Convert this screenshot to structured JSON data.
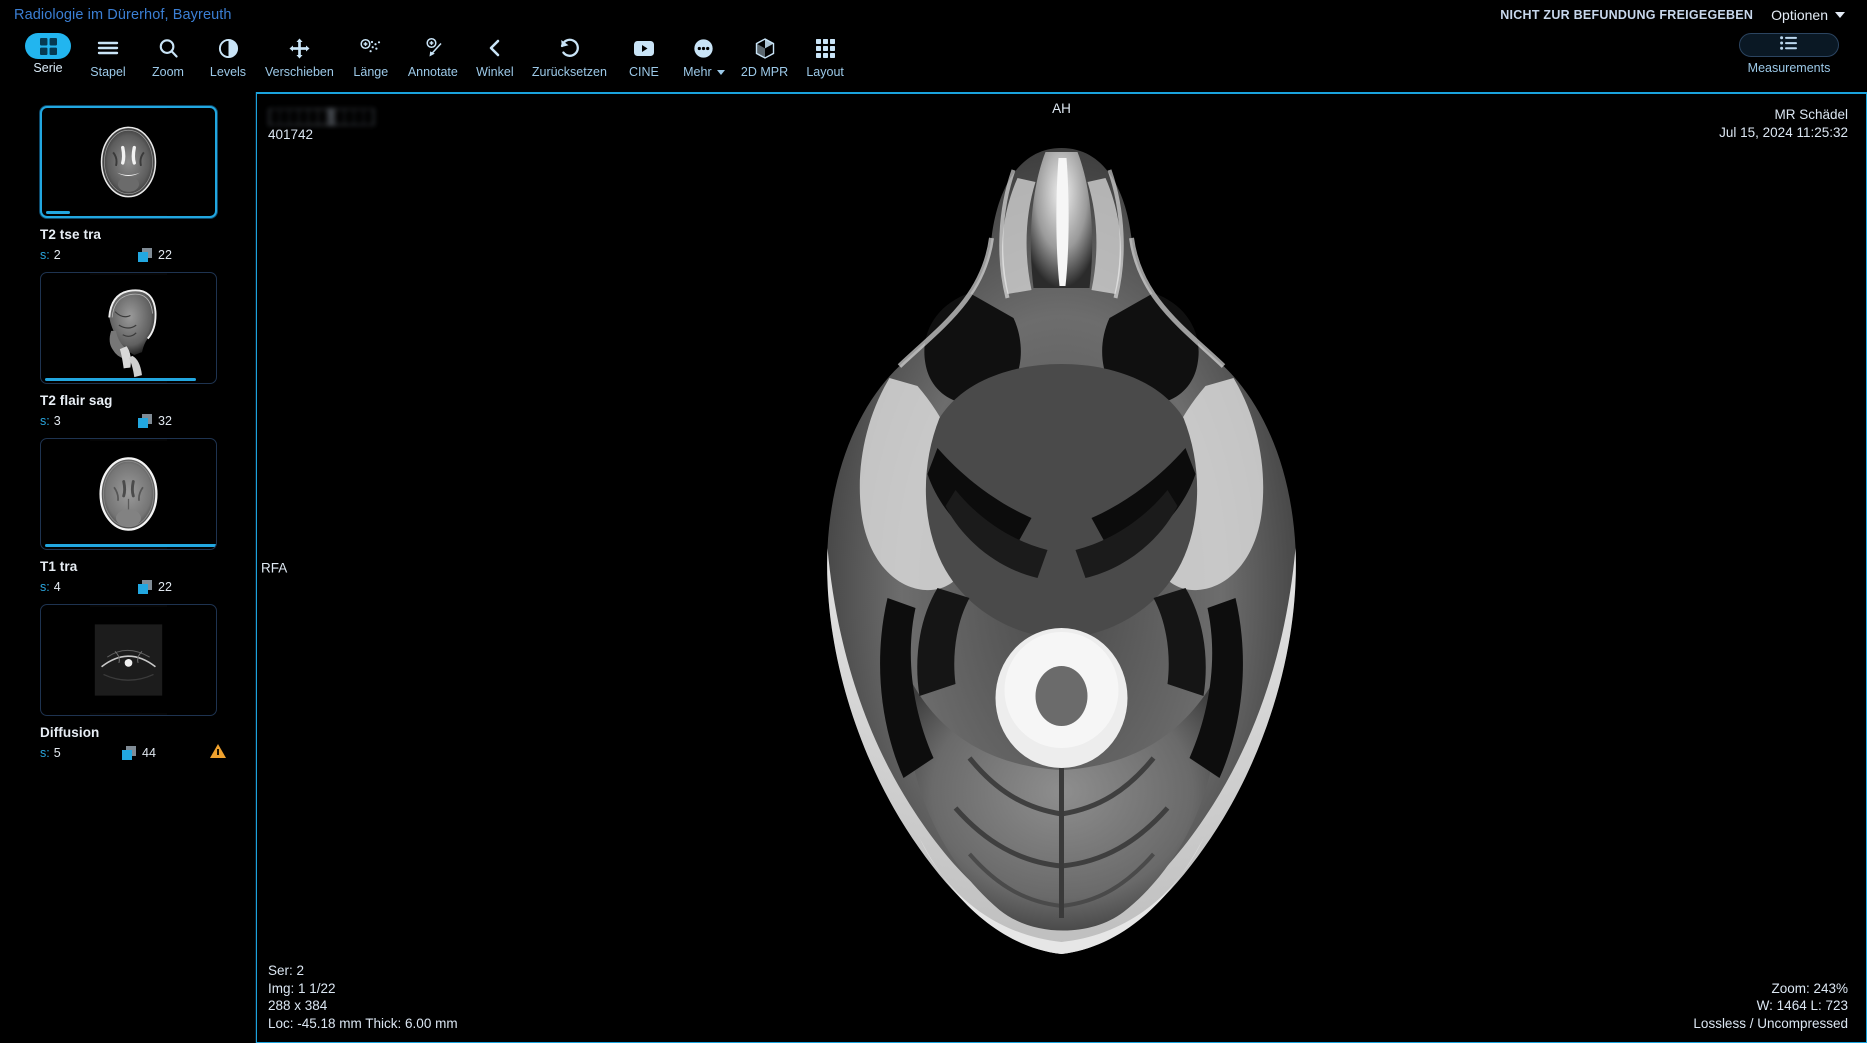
{
  "header": {
    "brand": "Radiologie im Dürerhof, Bayreuth",
    "not_released_notice": "NICHT ZUR BEFUNDUNG FREIGEGEBEN",
    "options_label": "Optionen"
  },
  "toolbar": {
    "tools": [
      {
        "label": "Serie",
        "icon": "grid-layout-icon",
        "active": true
      },
      {
        "label": "Stapel",
        "icon": "stack-lines-icon",
        "active": false
      },
      {
        "label": "Zoom",
        "icon": "magnifier-icon",
        "active": false
      },
      {
        "label": "Levels",
        "icon": "contrast-circle-icon",
        "active": false
      },
      {
        "label": "Verschieben",
        "icon": "move-arrows-icon",
        "active": false
      },
      {
        "label": "Länge",
        "icon": "length-measure-icon",
        "active": false
      },
      {
        "label": "Annotate",
        "icon": "annotate-arrow-icon",
        "active": false
      },
      {
        "label": "Winkel",
        "icon": "angle-chevron-icon",
        "active": false
      },
      {
        "label": "Zurücksetzen",
        "icon": "reset-undo-icon",
        "active": false
      },
      {
        "label": "CINE",
        "icon": "play-video-icon",
        "active": false
      },
      {
        "label": "Mehr",
        "icon": "more-dots-icon",
        "active": false,
        "dropdown": true
      },
      {
        "label": "2D MPR",
        "icon": "cube-icon",
        "active": false
      },
      {
        "label": "Layout",
        "icon": "grid-nine-icon",
        "active": false
      }
    ],
    "measurements_label": "Measurements",
    "measurements_icon": "list-lines-icon"
  },
  "sidebar": {
    "series": [
      {
        "title": "T2 tse tra",
        "series_label": "s:",
        "series_number": "2",
        "instances": "22",
        "progress_pct": 14,
        "selected": true,
        "warning": false,
        "modality_view": "axial-t2"
      },
      {
        "title": "T2 flair sag",
        "series_label": "s:",
        "series_number": "3",
        "instances": "32",
        "progress_pct": 86,
        "selected": false,
        "warning": false,
        "modality_view": "sagittal-flair"
      },
      {
        "title": "T1 tra",
        "series_label": "s:",
        "series_number": "4",
        "instances": "22",
        "progress_pct": 98,
        "selected": false,
        "warning": false,
        "modality_view": "axial-t1"
      },
      {
        "title": "Diffusion",
        "series_label": "s:",
        "series_number": "5",
        "instances": "44",
        "progress_pct": 0,
        "selected": false,
        "warning": true,
        "modality_view": "diffusion"
      }
    ]
  },
  "viewport": {
    "patient_name": "██████, ████",
    "patient_id": "401742",
    "study_description": "MR Schädel",
    "study_datetime": "Jul 15, 2024 11:25:32",
    "orientation_top": "AH",
    "orientation_left": "RFA",
    "series_line": "Ser: 2",
    "image_line": "Img: 1 1/22",
    "dimensions_line": "288 x 384",
    "location_line": "Loc: -45.18 mm Thick: 6.00 mm",
    "zoom_line": "Zoom: 243%",
    "window_level_line": "W: 1464 L: 723",
    "compression_line": "Lossless / Uncompressed"
  },
  "colors": {
    "accent": "#22a7e0",
    "brand_link": "#3b7fd4",
    "warning": "#f0a22e",
    "tool_label": "#9cc9e8",
    "overlay_text": "#dbe6f2"
  }
}
